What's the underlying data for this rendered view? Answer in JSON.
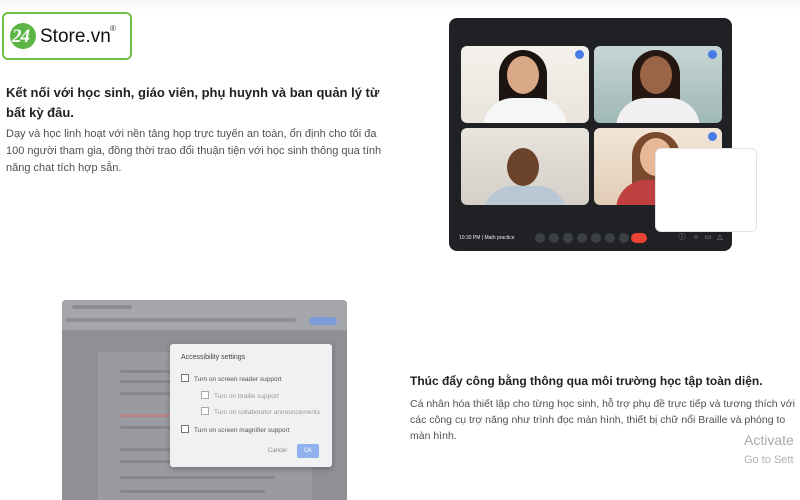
{
  "logo": {
    "number": "24",
    "word": "Store.vn",
    "reg": "®"
  },
  "section1": {
    "heading": "Kết nối với học sinh, giáo viên, phụ huynh và ban quản lý từ bất kỳ đâu.",
    "body": "Dạy và học linh hoạt với nền tảng họp trực tuyến an toàn, ổn định cho tối đa 100 người tham gia, đồng thời trao đổi thuận tiện với học sinh thông qua tính năng chat tích hợp sẵn."
  },
  "video_call": {
    "time_label": "10:30 PM | Math practice",
    "tiles": [
      "participant-1",
      "participant-2",
      "participant-3",
      "participant-4"
    ]
  },
  "accessibility_dialog": {
    "title": "Accessibility settings",
    "options": [
      "Turn on screen reader support",
      "Turn on braille support",
      "Turn on collaborator announcements",
      "Turn on screen magnifier support"
    ],
    "cancel_label": "Cancel",
    "ok_label": "Ok"
  },
  "section2": {
    "heading": "Thúc đẩy công bằng thông qua môi trường học tập toàn diện.",
    "body": "Cá nhân hóa thiết lập cho từng học sinh, hỗ trợ phụ đề trực tiếp và tương thích với các công cụ trợ năng như trình đọc màn hình, thiết bị chữ nổi Braille và phóng to màn hình."
  },
  "watermark": {
    "line1": "Activate",
    "line2": "Go to Sett"
  },
  "colors": {
    "logo_green": "#5cb545",
    "call_bg": "#202124",
    "end_call": "#ea4335",
    "ok_button": "#8fb2ee"
  }
}
